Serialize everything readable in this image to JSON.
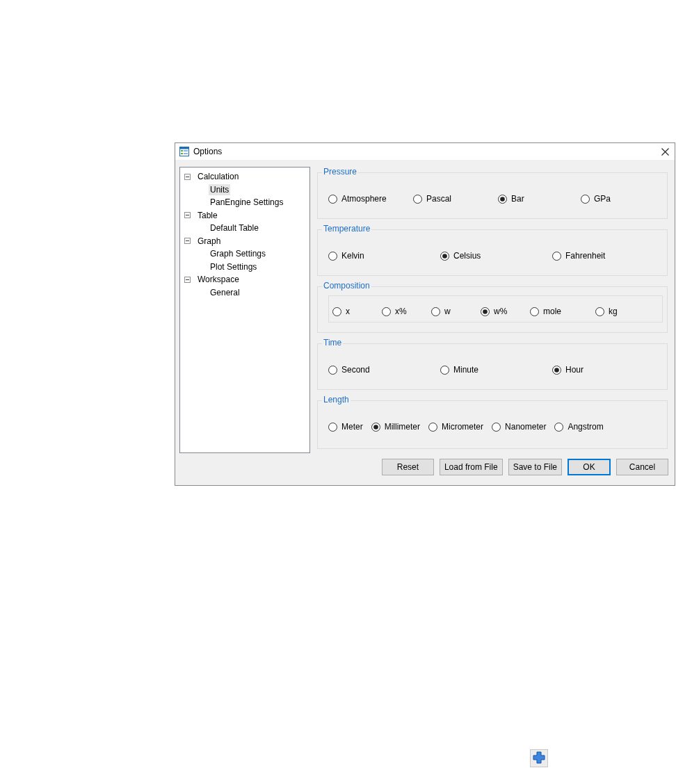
{
  "window": {
    "title": "Options"
  },
  "tree": [
    {
      "label": "Calculation",
      "expanded": true,
      "selected": false,
      "children": [
        {
          "label": "Units",
          "selected": true
        },
        {
          "label": "PanEngine Settings",
          "selected": false
        }
      ]
    },
    {
      "label": "Table",
      "expanded": true,
      "selected": false,
      "children": [
        {
          "label": "Default Table",
          "selected": false
        }
      ]
    },
    {
      "label": "Graph",
      "expanded": true,
      "selected": false,
      "children": [
        {
          "label": "Graph Settings",
          "selected": false
        },
        {
          "label": "Plot Settings",
          "selected": false
        }
      ]
    },
    {
      "label": "Workspace",
      "expanded": true,
      "selected": false,
      "children": [
        {
          "label": "General",
          "selected": false
        }
      ]
    }
  ],
  "groups": [
    {
      "title": "Pressure",
      "kind": "plain",
      "options": [
        {
          "label": "Atmosphere",
          "selected": false
        },
        {
          "label": "Pascal",
          "selected": false
        },
        {
          "label": "Bar",
          "selected": true
        },
        {
          "label": "GPa",
          "selected": false
        }
      ]
    },
    {
      "title": "Temperature",
      "kind": "plain",
      "options": [
        {
          "label": "Kelvin",
          "selected": false
        },
        {
          "label": "Celsius",
          "selected": true
        },
        {
          "label": "Fahrenheit",
          "selected": false
        }
      ]
    },
    {
      "title": "Composition",
      "kind": "boxed",
      "options": [
        {
          "label": "x",
          "selected": false
        },
        {
          "label": "x%",
          "selected": false
        },
        {
          "label": "w",
          "selected": false
        },
        {
          "label": "w%",
          "selected": true
        },
        {
          "label": "mole",
          "selected": false
        },
        {
          "label": "kg",
          "selected": false
        }
      ]
    },
    {
      "title": "Time",
      "kind": "plain",
      "options": [
        {
          "label": "Second",
          "selected": false
        },
        {
          "label": "Minute",
          "selected": false
        },
        {
          "label": "Hour",
          "selected": true
        }
      ]
    },
    {
      "title": "Length",
      "kind": "plain",
      "options": [
        {
          "label": "Meter",
          "selected": false
        },
        {
          "label": "Millimeter",
          "selected": true
        },
        {
          "label": "Micrometer",
          "selected": false
        },
        {
          "label": "Nanometer",
          "selected": false
        },
        {
          "label": "Angstrom",
          "selected": false
        }
      ]
    }
  ],
  "buttons": [
    {
      "label": "Reset",
      "default": false
    },
    {
      "label": "Load from File",
      "default": false
    },
    {
      "label": "Save to File",
      "default": false
    },
    {
      "label": "OK",
      "default": true
    },
    {
      "label": "Cancel",
      "default": false
    }
  ]
}
